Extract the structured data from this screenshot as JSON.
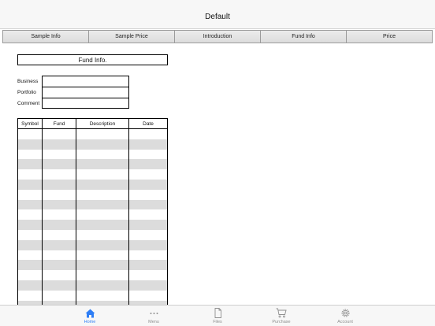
{
  "navbar": {
    "title": "Default"
  },
  "tabs": [
    {
      "label": "Sample Info"
    },
    {
      "label": "Sample Price"
    },
    {
      "label": "Introduction"
    },
    {
      "label": "Fund Info"
    },
    {
      "label": "Price"
    }
  ],
  "form": {
    "title": "Fund Info.",
    "fields": [
      {
        "label": "Business",
        "value": ""
      },
      {
        "label": "Portfolio",
        "value": ""
      },
      {
        "label": "Comment",
        "value": ""
      }
    ]
  },
  "table": {
    "columns": [
      "Symbol",
      "Fund",
      "Description",
      "Date"
    ],
    "rows": []
  },
  "tabbar": {
    "items": [
      {
        "label": "Home",
        "icon": "home-icon",
        "active": true
      },
      {
        "label": "Menu",
        "icon": "more-icon",
        "active": false
      },
      {
        "label": "Files",
        "icon": "file-icon",
        "active": false
      },
      {
        "label": "Purchase",
        "icon": "cart-icon",
        "active": false
      },
      {
        "label": "Account",
        "icon": "gear-icon",
        "active": false
      }
    ],
    "active_color": "#2f7ef5",
    "inactive_color": "#8e8e8e"
  }
}
